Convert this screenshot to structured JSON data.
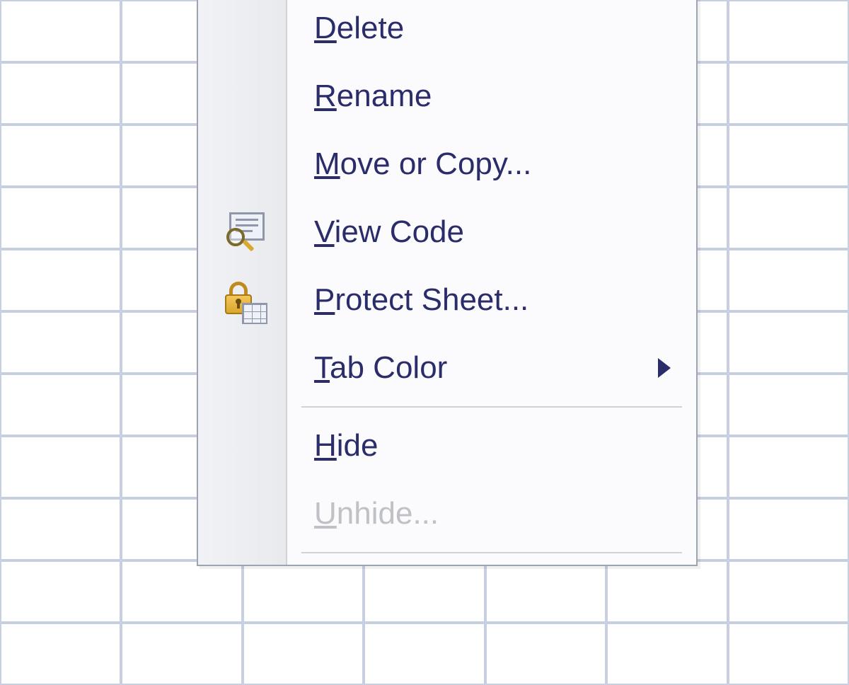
{
  "context_menu": {
    "items": [
      {
        "label": "Delete",
        "accel": "D",
        "icon": null,
        "enabled": true,
        "has_submenu": false
      },
      {
        "label": "Rename",
        "accel": "R",
        "icon": null,
        "enabled": true,
        "has_submenu": false
      },
      {
        "label": "Move or Copy...",
        "accel": "M",
        "icon": null,
        "enabled": true,
        "has_submenu": false
      },
      {
        "label": "View Code",
        "accel": "V",
        "icon": "view-code-icon",
        "enabled": true,
        "has_submenu": false
      },
      {
        "label": "Protect Sheet...",
        "accel": "P",
        "icon": "protect-sheet-icon",
        "enabled": true,
        "has_submenu": false
      },
      {
        "label": "Tab Color",
        "accel": "T",
        "icon": null,
        "enabled": true,
        "has_submenu": true
      },
      {
        "separator": true
      },
      {
        "label": "Hide",
        "accel": "H",
        "icon": null,
        "enabled": true,
        "has_submenu": false
      },
      {
        "label": "Unhide...",
        "accel": "U",
        "icon": null,
        "enabled": false,
        "has_submenu": false
      },
      {
        "separator": true
      }
    ]
  }
}
